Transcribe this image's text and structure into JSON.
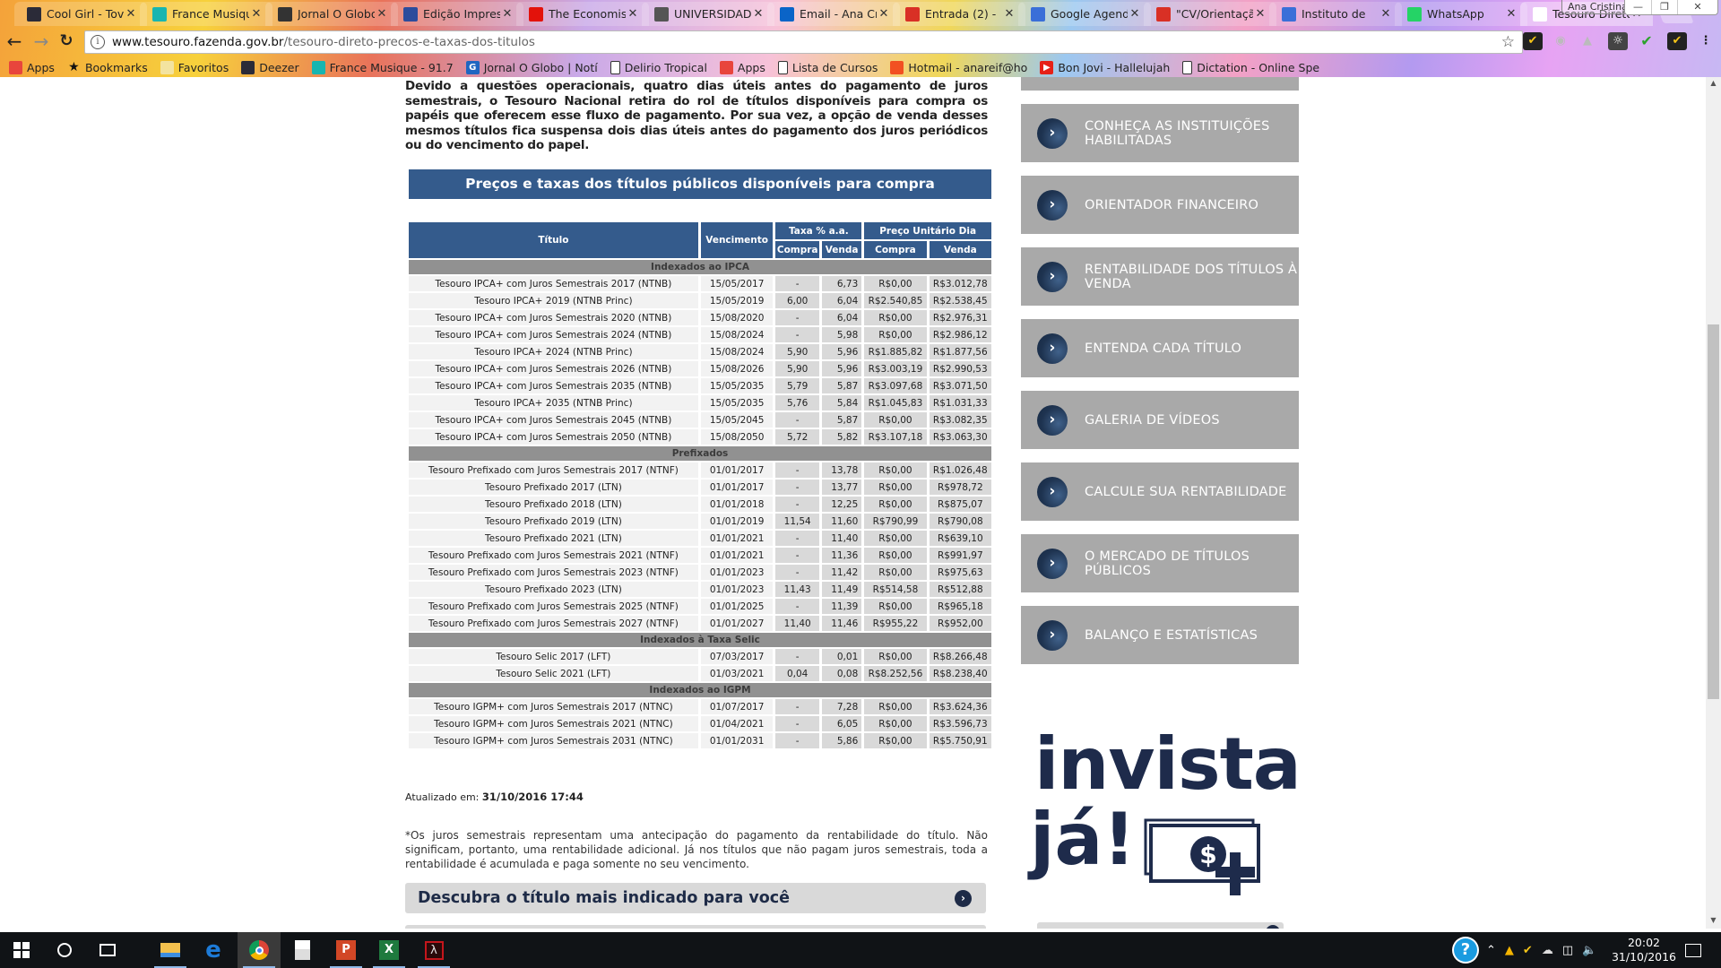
{
  "browser": {
    "tabs": [
      {
        "label": "Cool Girl - Tove",
        "favicon": "deezer",
        "color": "#2b2b38"
      },
      {
        "label": "France Musique",
        "favicon": "france-musique",
        "color": "#18b5b0"
      },
      {
        "label": "Jornal O Globo",
        "favicon": "loading-spinner",
        "color": "#333333"
      },
      {
        "label": "Edição Impressa",
        "favicon": "valor",
        "color": "#2c4c9c"
      },
      {
        "label": "The Economist",
        "favicon": "economist",
        "color": "#e3120b"
      },
      {
        "label": "UNIVERSIDADE",
        "favicon": "university",
        "color": "#555555"
      },
      {
        "label": "Email - Ana Cristina",
        "favicon": "outlook",
        "color": "#0a64c8"
      },
      {
        "label": "Entrada (2) - ",
        "favicon": "gmail",
        "color": "#d93025"
      },
      {
        "label": "Google Agenda",
        "favicon": "calendar",
        "color": "#3a6fd8"
      },
      {
        "label": "\"CV/Orientação",
        "favicon": "gmail",
        "color": "#d93025"
      },
      {
        "label": "Instituto de ",
        "favicon": "calendar",
        "color": "#3a6fd8"
      },
      {
        "label": "WhatsApp",
        "favicon": "whatsapp",
        "color": "#25d366"
      },
      {
        "label": "Tesouro Direto",
        "favicon": "tesouro",
        "color": "#ffffff",
        "active": true
      }
    ],
    "profile_name": "Ana Cristina",
    "url_host": "www.tesouro.fazenda.gov.br",
    "url_path": "/tesouro-direto-precos-e-taxas-dos-titulos",
    "bookmarks": [
      {
        "label": "Apps",
        "icon": "apps-grid-icon"
      },
      {
        "label": "Bookmarks",
        "icon": "star-icon"
      },
      {
        "label": "Favoritos",
        "icon": "folder-icon"
      },
      {
        "label": "Deezer",
        "icon": "deezer-icon"
      },
      {
        "label": "France Musique - 91.7",
        "icon": "france-musique-icon"
      },
      {
        "label": "Jornal O Globo | Notí",
        "icon": "globo-icon"
      },
      {
        "label": "Delirio Tropical",
        "icon": "page-icon"
      },
      {
        "label": "Apps",
        "icon": "apps-grid-icon"
      },
      {
        "label": "Lista de Cursos",
        "icon": "page-icon"
      },
      {
        "label": "Hotmail - anareif@ho",
        "icon": "windows-icon"
      },
      {
        "label": "Bon Jovi - Hallelujah",
        "icon": "youtube-icon"
      },
      {
        "label": "Dictation - Online Spe",
        "icon": "page-icon"
      }
    ]
  },
  "page": {
    "intro": "Devido a questões operacionais, quatro dias úteis antes do pagamento de juros semestrais, o Tesouro Nacional retira do rol de títulos disponíveis para compra os papéis que oferecem esse fluxo de pagamento. Por sua vez, a opção de venda desses mesmos títulos fica suspensa dois dias úteis antes do pagamento dos juros periódicos ou do vencimento do papel.",
    "table_title": "Preços e taxas dos títulos públicos disponíveis para compra",
    "headers": {
      "titulo": "Título",
      "vencimento": "Vencimento",
      "taxa": "Taxa % a.a.",
      "preco": "Preço Unitário Dia",
      "compra": "Compra",
      "venda": "Venda"
    },
    "sections": [
      {
        "name": "Indexados ao IPCA",
        "rows": [
          [
            "Tesouro IPCA+ com Juros Semestrais 2017 (NTNB)",
            "15/05/2017",
            "-",
            "6,73",
            "R$0,00",
            "R$3.012,78"
          ],
          [
            "Tesouro IPCA+ 2019 (NTNB Princ)",
            "15/05/2019",
            "6,00",
            "6,04",
            "R$2.540,85",
            "R$2.538,45"
          ],
          [
            "Tesouro IPCA+ com Juros Semestrais 2020 (NTNB)",
            "15/08/2020",
            "-",
            "6,04",
            "R$0,00",
            "R$2.976,31"
          ],
          [
            "Tesouro IPCA+ com Juros Semestrais 2024 (NTNB)",
            "15/08/2024",
            "-",
            "5,98",
            "R$0,00",
            "R$2.986,12"
          ],
          [
            "Tesouro IPCA+ 2024 (NTNB Princ)",
            "15/08/2024",
            "5,90",
            "5,96",
            "R$1.885,82",
            "R$1.877,56"
          ],
          [
            "Tesouro IPCA+ com Juros Semestrais 2026 (NTNB)",
            "15/08/2026",
            "5,90",
            "5,96",
            "R$3.003,19",
            "R$2.990,53"
          ],
          [
            "Tesouro IPCA+ com Juros Semestrais 2035 (NTNB)",
            "15/05/2035",
            "5,79",
            "5,87",
            "R$3.097,68",
            "R$3.071,50"
          ],
          [
            "Tesouro IPCA+ 2035 (NTNB Princ)",
            "15/05/2035",
            "5,76",
            "5,84",
            "R$1.045,83",
            "R$1.031,33"
          ],
          [
            "Tesouro IPCA+ com Juros Semestrais 2045 (NTNB)",
            "15/05/2045",
            "-",
            "5,87",
            "R$0,00",
            "R$3.082,35"
          ],
          [
            "Tesouro IPCA+ com Juros Semestrais 2050 (NTNB)",
            "15/08/2050",
            "5,72",
            "5,82",
            "R$3.107,18",
            "R$3.063,30"
          ]
        ]
      },
      {
        "name": "Prefixados",
        "rows": [
          [
            "Tesouro Prefixado com Juros Semestrais 2017 (NTNF)",
            "01/01/2017",
            "-",
            "13,78",
            "R$0,00",
            "R$1.026,48"
          ],
          [
            "Tesouro Prefixado 2017 (LTN)",
            "01/01/2017",
            "-",
            "13,77",
            "R$0,00",
            "R$978,72"
          ],
          [
            "Tesouro Prefixado 2018 (LTN)",
            "01/01/2018",
            "-",
            "12,25",
            "R$0,00",
            "R$875,07"
          ],
          [
            "Tesouro Prefixado 2019 (LTN)",
            "01/01/2019",
            "11,54",
            "11,60",
            "R$790,99",
            "R$790,08"
          ],
          [
            "Tesouro Prefixado 2021 (LTN)",
            "01/01/2021",
            "-",
            "11,40",
            "R$0,00",
            "R$639,10"
          ],
          [
            "Tesouro Prefixado com Juros Semestrais 2021 (NTNF)",
            "01/01/2021",
            "-",
            "11,36",
            "R$0,00",
            "R$991,97"
          ],
          [
            "Tesouro Prefixado com Juros Semestrais 2023 (NTNF)",
            "01/01/2023",
            "-",
            "11,42",
            "R$0,00",
            "R$975,63"
          ],
          [
            "Tesouro Prefixado 2023 (LTN)",
            "01/01/2023",
            "11,43",
            "11,49",
            "R$514,58",
            "R$512,88"
          ],
          [
            "Tesouro Prefixado com Juros Semestrais 2025 (NTNF)",
            "01/01/2025",
            "-",
            "11,39",
            "R$0,00",
            "R$965,18"
          ],
          [
            "Tesouro Prefixado com Juros Semestrais 2027 (NTNF)",
            "01/01/2027",
            "11,40",
            "11,46",
            "R$955,22",
            "R$952,00"
          ]
        ]
      },
      {
        "name": "Indexados à Taxa Selic",
        "rows": [
          [
            "Tesouro Selic 2017 (LFT)",
            "07/03/2017",
            "-",
            "0,01",
            "R$0,00",
            "R$8.266,48"
          ],
          [
            "Tesouro Selic 2021 (LFT)",
            "01/03/2021",
            "0,04",
            "0,08",
            "R$8.252,56",
            "R$8.238,40"
          ]
        ]
      },
      {
        "name": "Indexados ao IGPM",
        "rows": [
          [
            "Tesouro IGPM+ com Juros Semestrais 2017 (NTNC)",
            "01/07/2017",
            "-",
            "7,28",
            "R$0,00",
            "R$3.624,36"
          ],
          [
            "Tesouro IGPM+ com Juros Semestrais 2021 (NTNC)",
            "01/04/2021",
            "-",
            "6,05",
            "R$0,00",
            "R$3.596,73"
          ],
          [
            "Tesouro IGPM+ com Juros Semestrais 2031 (NTNC)",
            "01/01/2031",
            "-",
            "5,86",
            "R$0,00",
            "R$5.750,91"
          ]
        ]
      }
    ],
    "updated_label": "Atualizado em:",
    "updated_value": "31/10/2016 17:44",
    "footnote": "*Os juros semestrais representam uma antecipação do pagamento da rentabilidade do título. Não significam, portanto, uma rentabilidade adicional. Já nos títulos que não pagam juros semestrais, toda a rentabilidade é acumulada e paga somente no seu vencimento.",
    "cta_discover": "Descubra o título mais indicado para você"
  },
  "sidebar": {
    "items": [
      "",
      "CONHEÇA AS INSTITUIÇÕES HABILITADAS",
      "ORIENTADOR FINANCEIRO",
      "RENTABILIDADE DOS TÍTULOS À VENDA",
      "ENTENDA CADA TÍTULO",
      "GALERIA DE VÍDEOS",
      "CALCULE SUA RENTABILIDADE",
      "O MERCADO DE TÍTULOS PÚBLICOS",
      "BALANÇO E ESTATÍSTICAS"
    ],
    "banner_line1": "invista",
    "banner_line2": "já!",
    "colors": {
      "navy": "#1e2b4b",
      "item_bg": "#a9a9a9",
      "table_header": "#345b8c"
    }
  },
  "taskbar": {
    "apps": [
      "file-explorer",
      "edge",
      "chrome",
      "calculator",
      "powerpoint",
      "excel",
      "acrobat"
    ],
    "active_app": "chrome",
    "time": "20:02",
    "date": "31/10/2016"
  }
}
